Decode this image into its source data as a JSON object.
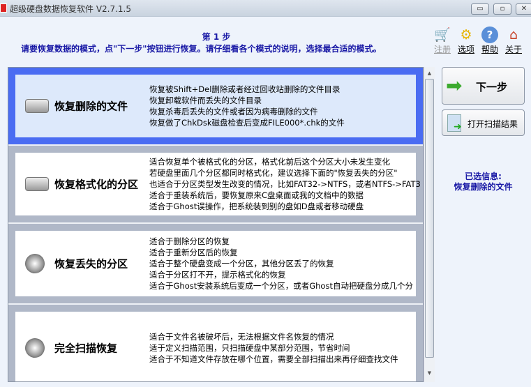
{
  "window": {
    "title": "超级硬盘数据恢复软件 V2.7.1.5",
    "min": "▭",
    "max": "▫",
    "close": "✕"
  },
  "header": {
    "step": "第 1 步",
    "instruction": "请要恢复数据的模式，点\"下一步\"按钮进行恢复。请仔细看各个模式的说明，选择最合适的模式。"
  },
  "toolbar": [
    {
      "label": "注册",
      "icon": "🛒"
    },
    {
      "label": "选项",
      "icon": "⚙"
    },
    {
      "label": "帮助",
      "icon": "?"
    },
    {
      "label": "关于",
      "icon": "⌂"
    }
  ],
  "modes": [
    {
      "name": "恢复删除的文件",
      "selected": true,
      "lines": [
        "恢复被Shift+Del删除或者经过回收站删除的文件目录",
        "恢复卸载软件而丢失的文件目录",
        "恢复杀毒后丢失的文件或者因为病毒删除的文件",
        "恢复做了ChkDsk磁盘检查后变成FILE000*.chk的文件"
      ]
    },
    {
      "name": "恢复格式化的分区",
      "selected": false,
      "lines": [
        "适合恢复单个被格式化的分区，格式化前后这个分区大小未发生变化",
        "若硬盘里面几个分区都同时格式化，建议选择下面的\"恢复丢失的分区\"",
        "也适合于分区类型发生改变的情况，比如FAT32->NTFS，或者NTFS->FAT3",
        "适合于重装系统后，要恢复原来C盘桌面或我的文档中的数据",
        "适合于Ghost误操作，把系统装到别的盘如D盘或者移动硬盘"
      ]
    },
    {
      "name": "恢复丢失的分区",
      "selected": false,
      "lines": [
        "适合于删除分区的恢复",
        "适合于重新分区后的恢复",
        "适合于整个硬盘变成一个分区，其他分区丢了的恢复",
        "适合于分区打不开，提示格式化的恢复",
        "适合于Ghost安装系统后变成一个分区，或者Ghost自动把硬盘分成几个分"
      ]
    },
    {
      "name": "完全扫描恢复",
      "selected": false,
      "lines": [
        "适合于文件名被破坏后，无法根据文件名恢复的情况",
        "适于定义扫描范围，只扫描硬盘中某部分范围，节省时间",
        "适合于不知道文件存放在哪个位置，需要全部扫描出来再仔细查找文件"
      ]
    }
  ],
  "buttons": {
    "next": "下一步",
    "open_scan": "打开扫描结果"
  },
  "selected_info": {
    "label": "已选信息:",
    "value": "恢复删除的文件"
  }
}
